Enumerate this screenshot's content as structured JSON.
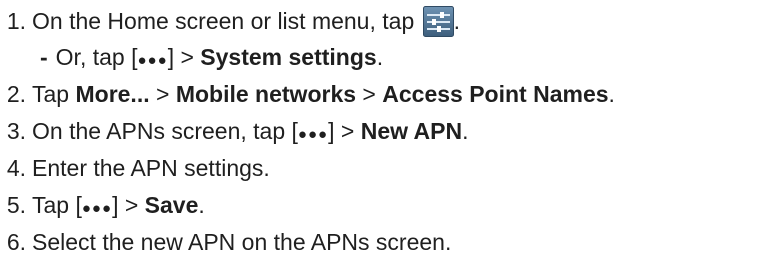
{
  "steps": [
    {
      "num": "1.",
      "pre": "On the Home screen or list menu, tap",
      "post": "."
    },
    {
      "sub_prefix": "-",
      "pre": "Or, tap [",
      "dots": "●●●",
      "mid": "] > ",
      "bold": "System settings",
      "post": "."
    },
    {
      "num": "2.",
      "pre": "Tap ",
      "b1": "More...",
      "s1": " > ",
      "b2": "Mobile networks",
      "s2": " > ",
      "b3": "Access Point Names",
      "post": "."
    },
    {
      "num": "3.",
      "pre": "On the APNs screen, tap [",
      "dots": "●●●",
      "mid": "] > ",
      "bold": "New APN",
      "post": "."
    },
    {
      "num": "4.",
      "text": "Enter the APN settings."
    },
    {
      "num": "5.",
      "pre": "Tap [",
      "dots": "●●●",
      "mid": "] > ",
      "bold": "Save",
      "post": "."
    },
    {
      "num": "6.",
      "text": "Select the new APN on the APNs screen."
    }
  ],
  "icons": {
    "settings": "settings-sliders-icon"
  },
  "colors": {
    "icon_bg": "#4a6f8f",
    "icon_slider": "#dce9f5",
    "text": "#1f1f1f"
  }
}
